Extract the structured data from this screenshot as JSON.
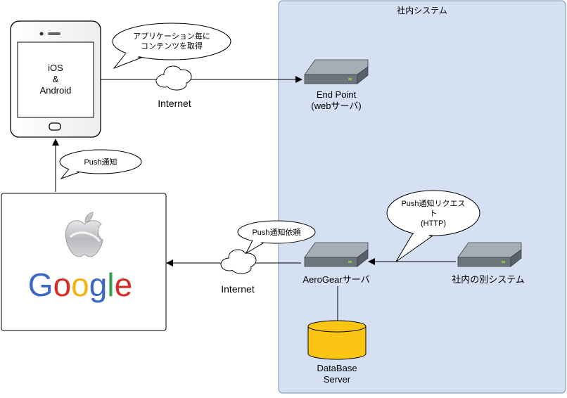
{
  "system": {
    "title": "社内システム"
  },
  "phone": {
    "line1": "iOS",
    "line2": "&",
    "line3": "Android"
  },
  "bubbles": {
    "app_content": {
      "line1": "アプリケーション毎に",
      "line2": "コンテンツを取得"
    },
    "push": {
      "text": "Push通知"
    },
    "push_request": {
      "text": "Push通知依頼"
    },
    "push_http": {
      "line1": "Push通知リクエス",
      "line2": "ト",
      "line3": "(HTTP)"
    }
  },
  "internet": {
    "top": "Internet",
    "bottom": "Internet"
  },
  "servers": {
    "endpoint": {
      "line1": "End Point",
      "line2": "(webサーバ)"
    },
    "aerogear": {
      "label": "AeroGearサーバ"
    },
    "other": {
      "label": "社内の別システム"
    }
  },
  "database": {
    "line1": "DataBase",
    "line2": "Server"
  },
  "providers": {
    "google": "Google",
    "apple_logo_icon": "apple-logo-icon"
  },
  "colors": {
    "system_bg": "#d5e0f2",
    "system_border": "#7a8ea8",
    "server_top": "#a7adb5",
    "server_front": "#6e747c",
    "db_fill": "#fcc514",
    "google_blue": "#3b67c6",
    "google_red": "#d52c26",
    "google_yellow": "#f1b310",
    "google_green": "#2f9d49"
  }
}
